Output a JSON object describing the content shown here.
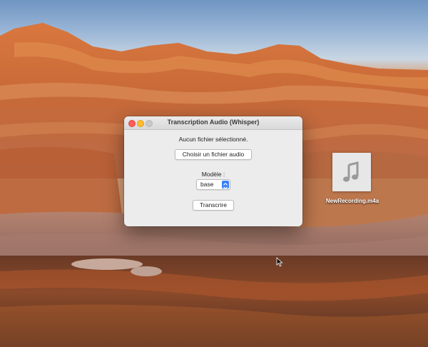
{
  "window": {
    "title": "Transcription Audio (Whisper)",
    "status_text": "Aucun fichier sélectionné.",
    "choose_button_label": "Choisir un fichier audio",
    "model_label": "Modèle :",
    "model_select_value": "base",
    "transcribe_button_label": "Transcrire"
  },
  "desktop": {
    "file_name": "NewRecording.m4a",
    "file_icon": "music-note-icon"
  },
  "colors": {
    "close": "#ff5f57",
    "minimize": "#febc2e",
    "select_accent": "#3b82f7"
  }
}
